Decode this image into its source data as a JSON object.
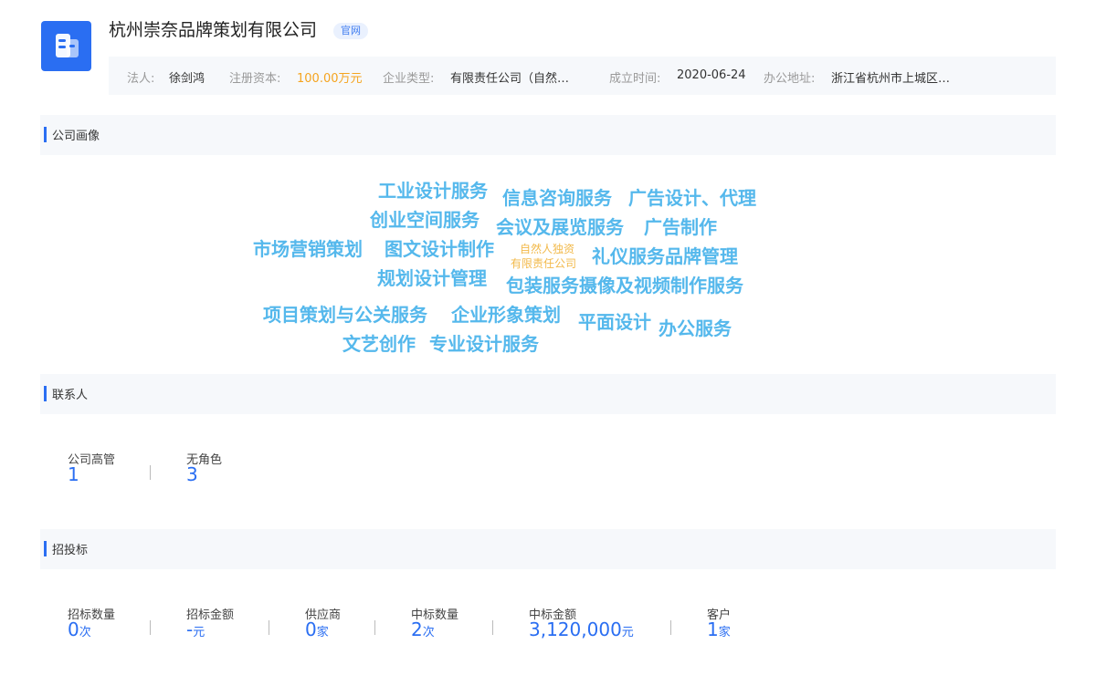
{
  "company": {
    "name": "杭州崇奈品牌策划有限公司",
    "badge": "官网"
  },
  "info": [
    {
      "label": "法人:",
      "value": "徐剑鸿"
    },
    {
      "label": "注册资本:",
      "value": "100.00万元"
    },
    {
      "label": "企业类型:",
      "value": "有限责任公司（自然…"
    },
    {
      "label": "成立时间:",
      "value": "2020-06-24"
    },
    {
      "label": "办公地址:",
      "value": "浙江省杭州市上城区…"
    }
  ],
  "portrait": {
    "title": "公司画像",
    "words": [
      "工业设计服务",
      "信息咨询服务",
      "广告设计、代理",
      "创业空间服务",
      "会议及展览服务",
      "广告制作",
      "市场营销策划",
      "图文设计制作",
      "自然人独资",
      "有限责任公司",
      "礼仪服务品牌管理",
      "规划设计管理",
      "包装服务摄像及视频制作服务",
      "项目策划与公关服务",
      "企业形象策划",
      "平面设计",
      "办公服务",
      "文艺创作",
      "专业设计服务"
    ]
  },
  "contacts": {
    "title": "联系人",
    "stats": [
      {
        "label": "公司高管",
        "value": "1",
        "unit": ""
      },
      {
        "label": "无角色",
        "value": "3",
        "unit": ""
      }
    ]
  },
  "bidding": {
    "title": "招投标",
    "stats": [
      {
        "label": "招标数量",
        "value": "0",
        "unit": "次"
      },
      {
        "label": "招标金额",
        "value": "-",
        "unit": "元"
      },
      {
        "label": "供应商",
        "value": "0",
        "unit": "家"
      },
      {
        "label": "中标数量",
        "value": "2",
        "unit": "次"
      },
      {
        "label": "中标金额",
        "value": "3,120,000",
        "unit": "元"
      },
      {
        "label": "客户",
        "value": "1",
        "unit": "家"
      }
    ]
  },
  "colors": {
    "accent": "#2a6ef2",
    "word": "#55b8ec",
    "orange": "#f5a41f"
  }
}
